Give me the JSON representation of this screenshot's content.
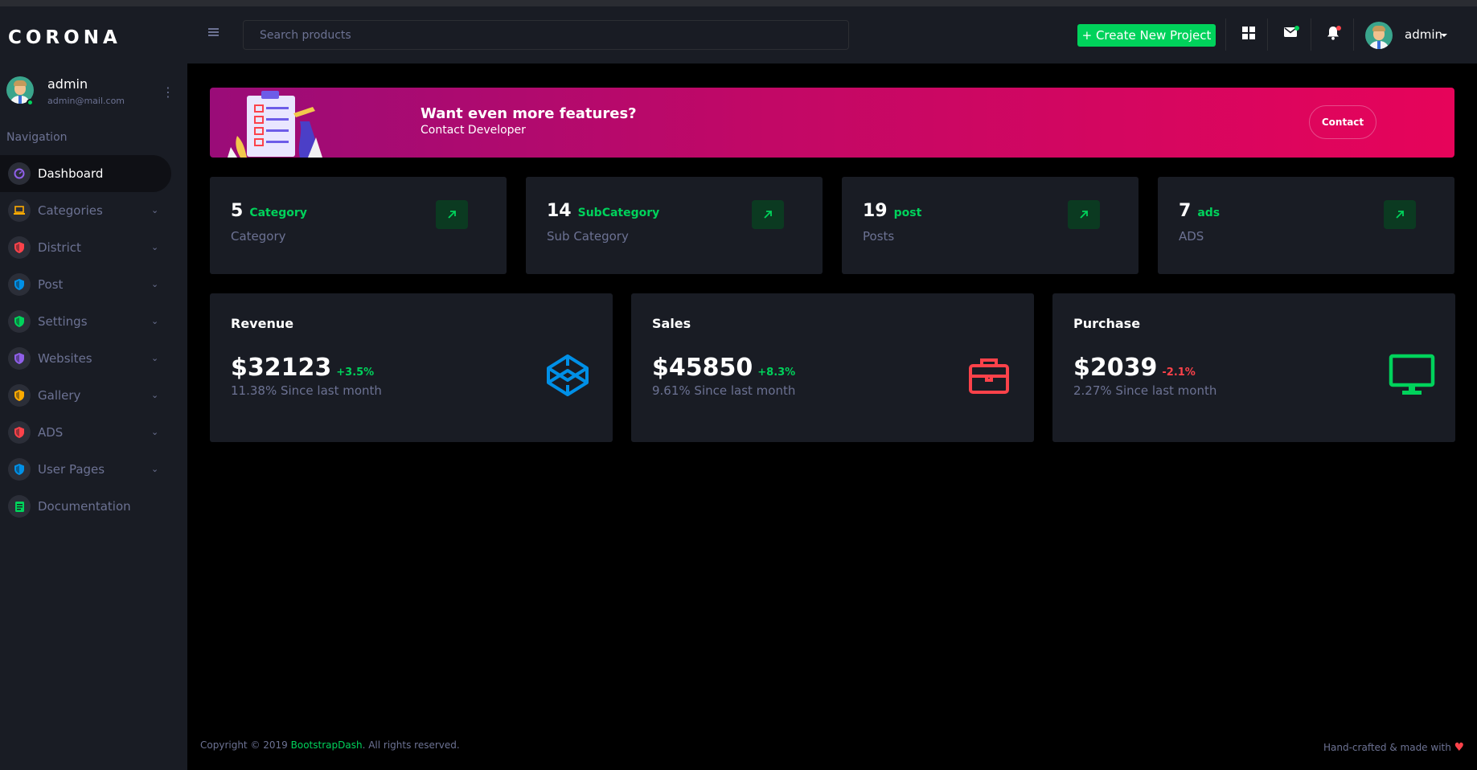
{
  "brand": "CORONA",
  "profile": {
    "name": "admin",
    "email": "admin@mail.com"
  },
  "nav": {
    "heading": "Navigation",
    "items": [
      {
        "label": "Dashboard",
        "icon": "speedometer-icon",
        "color": "#8f5fe8",
        "active": true,
        "chevron": false
      },
      {
        "label": "Categories",
        "icon": "laptop-icon",
        "color": "#ffab00",
        "chevron": true
      },
      {
        "label": "District",
        "icon": "security-icon",
        "color": "#fc424a",
        "chevron": true
      },
      {
        "label": "Post",
        "icon": "security-icon",
        "color": "#0090e7",
        "chevron": true
      },
      {
        "label": "Settings",
        "icon": "security-icon",
        "color": "#00d25b",
        "chevron": true
      },
      {
        "label": "Websites",
        "icon": "security-icon",
        "color": "#8f5fe8",
        "chevron": true
      },
      {
        "label": "Gallery",
        "icon": "security-icon",
        "color": "#ffab00",
        "chevron": true
      },
      {
        "label": "ADS",
        "icon": "security-icon",
        "color": "#fc424a",
        "chevron": true
      },
      {
        "label": "User Pages",
        "icon": "security-icon",
        "color": "#0090e7",
        "chevron": true
      },
      {
        "label": "Documentation",
        "icon": "document-icon",
        "color": "#00d25b",
        "chevron": false
      }
    ]
  },
  "topbar": {
    "search_placeholder": "Search products",
    "create_label": "+ Create New Project",
    "username": "admin"
  },
  "banner": {
    "title": "Want even more features?",
    "subtitle": "Contact Developer",
    "button": "Contact"
  },
  "stats": [
    {
      "number": "5",
      "tag": "Category",
      "label": "Category"
    },
    {
      "number": "14",
      "tag": "SubCategory",
      "label": "Sub Category"
    },
    {
      "number": "19",
      "tag": "post",
      "label": "Posts"
    },
    {
      "number": "7",
      "tag": "ads",
      "label": "ADS"
    }
  ],
  "cards": [
    {
      "title": "Revenue",
      "value": "$32123",
      "delta": "+3.5%",
      "delta_color": "#00d25b",
      "since": "11.38% Since last month",
      "icon": "codepen-icon",
      "icon_color": "#0090e7"
    },
    {
      "title": "Sales",
      "value": "$45850",
      "delta": "+8.3%",
      "delta_color": "#00d25b",
      "since": "9.61% Since last month",
      "icon": "briefcase-icon",
      "icon_color": "#fc424a"
    },
    {
      "title": "Purchase",
      "value": "$2039",
      "delta": "-2.1%",
      "delta_color": "#fc424a",
      "since": "2.27% Since last month",
      "icon": "monitor-icon",
      "icon_color": "#00d25b"
    }
  ],
  "footer": {
    "copyright_prefix": "Copyright © 2019 ",
    "link": "BootstrapDash",
    "copyright_suffix": ". All rights reserved.",
    "right": "Hand-crafted & made with "
  }
}
